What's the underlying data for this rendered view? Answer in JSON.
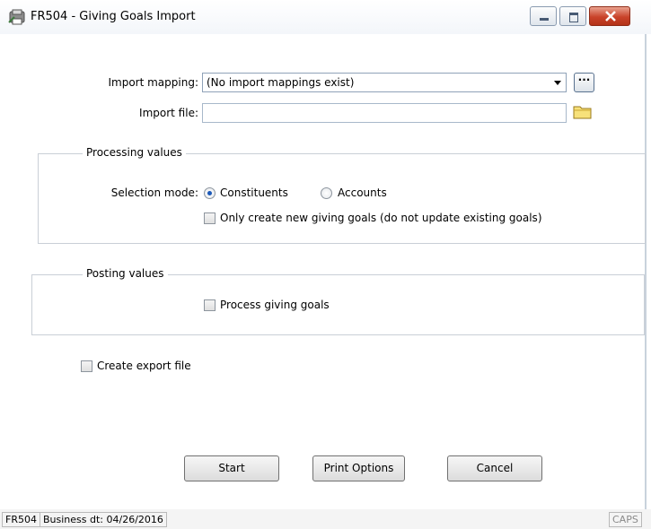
{
  "window": {
    "title": "FR504 - Giving Goals Import",
    "icon": "import-app-icon"
  },
  "form": {
    "import_mapping_label": "Import mapping:",
    "import_mapping_value": "(No import mappings exist)",
    "browse_mappings_label": "···",
    "import_file_label": "Import file:",
    "import_file_value": ""
  },
  "processing": {
    "legend": "Processing values",
    "selection_mode_label": "Selection mode:",
    "options": [
      "Constituents",
      "Accounts"
    ],
    "selected": "Constituents",
    "only_new_label": "Only create new giving goals (do not update existing goals)",
    "only_new_checked": false
  },
  "posting": {
    "legend": "Posting values",
    "process_label": "Process giving goals",
    "process_checked": false
  },
  "export": {
    "label": "Create export file",
    "checked": false
  },
  "buttons": {
    "start": "Start",
    "print_options": "Print Options",
    "cancel": "Cancel"
  },
  "status": {
    "code": "FR504",
    "business_date": "Business dt: 04/26/2016",
    "caps": "CAPS"
  }
}
